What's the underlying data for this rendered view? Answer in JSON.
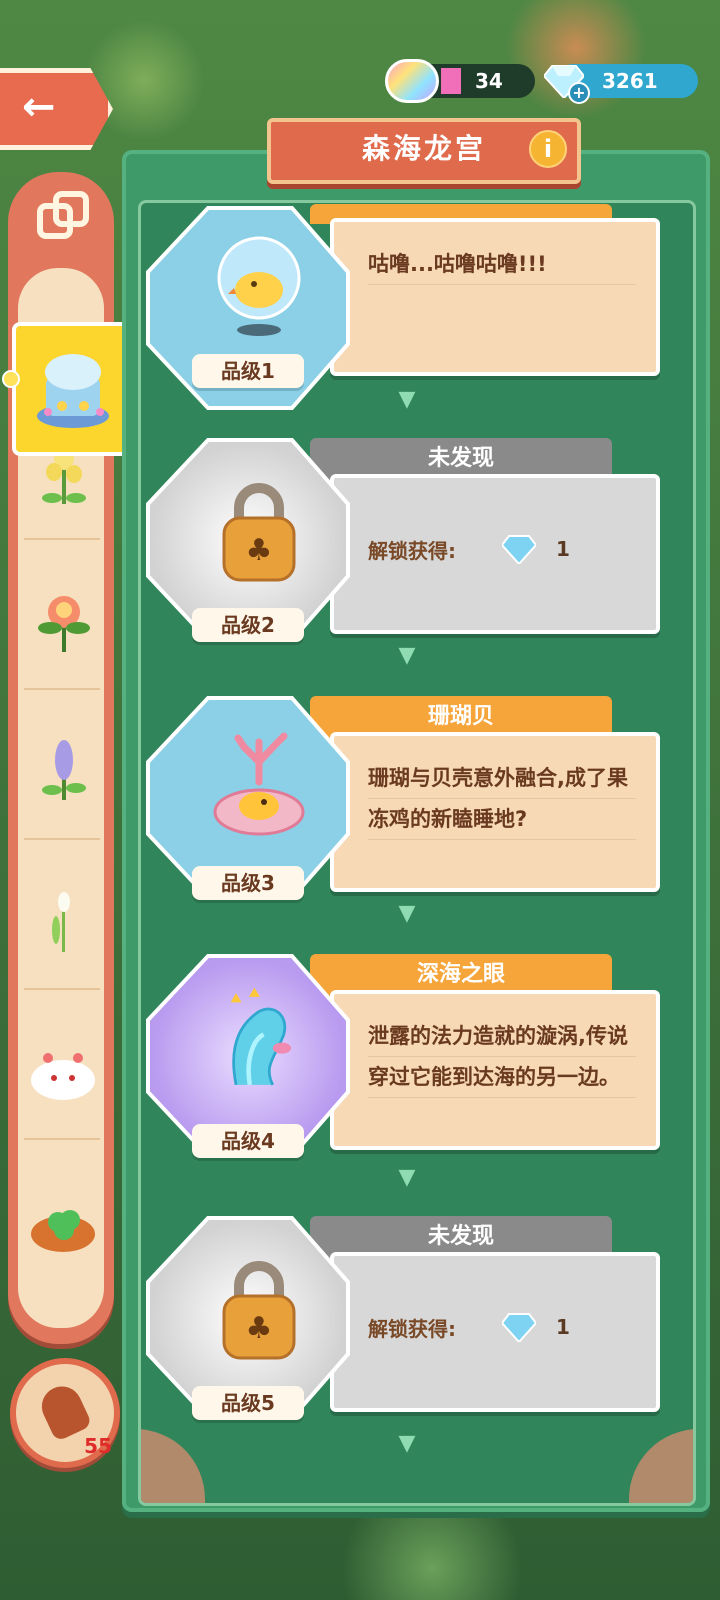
{
  "header": {
    "title": "森海龙宫",
    "info_icon": "info-icon",
    "back_icon": "back-arrow-icon"
  },
  "resources": {
    "rainbow": {
      "icon": "rainbow-cloud-icon",
      "value": "34"
    },
    "gems": {
      "icon": "diamond-icon",
      "value": "3261"
    }
  },
  "sidebar": {
    "top_icon": "stack-icon",
    "items": [
      {
        "name": "sea-palace",
        "active": true
      },
      {
        "name": "yellow-flower"
      },
      {
        "name": "peony-flower"
      },
      {
        "name": "lavender-flower"
      },
      {
        "name": "tulip-sprout"
      },
      {
        "name": "cloud-chick"
      },
      {
        "name": "clover-basket"
      }
    ],
    "hint_count": "55"
  },
  "cards": [
    {
      "title": "",
      "description": "咕噜...咕噜咕噜!!!",
      "grade": "品级1",
      "state": "found",
      "art": "bubble-chick"
    },
    {
      "title": "未发现",
      "unlock_label": "解锁获得:",
      "unlock_count": "1",
      "grade": "品级2",
      "state": "locked",
      "art": "lock"
    },
    {
      "title": "珊瑚贝",
      "description": "珊瑚与贝壳意外融合,成了果冻鸡的新瞌睡地?",
      "grade": "品级3",
      "state": "found",
      "art": "coral-shell"
    },
    {
      "title": "深海之眼",
      "description": "泄露的法力造就的漩涡,传说穿过它能到达海的另一边。",
      "grade": "品级4",
      "state": "found",
      "art": "sea-vortex"
    },
    {
      "title": "未发现",
      "unlock_label": "解锁获得:",
      "unlock_count": "1",
      "grade": "品级5",
      "state": "locked",
      "art": "lock"
    }
  ],
  "colors": {
    "accent": "#e06a4c",
    "panel": "#3f9a6a",
    "gem": "#2fa7cf",
    "gold": "#f5a53a"
  }
}
